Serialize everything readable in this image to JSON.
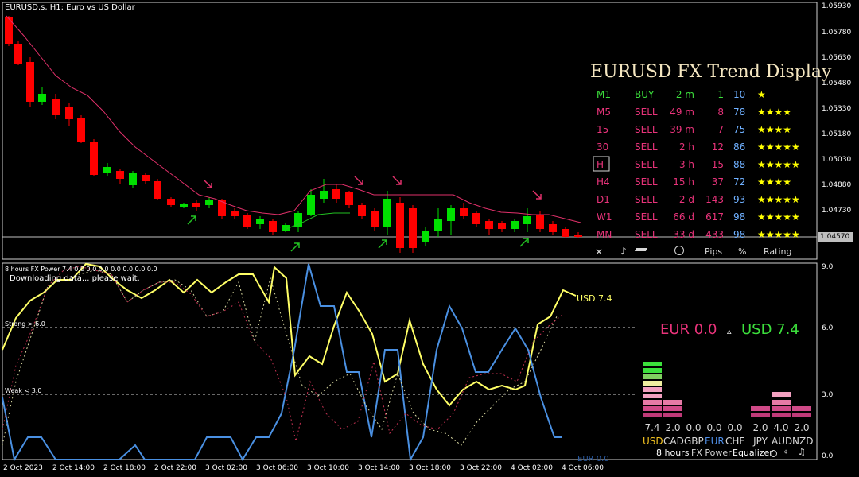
{
  "symbol_title": "EURUSD.s, H1:  Euro vs US Dollar",
  "price_axis": [
    "1.05930",
    "1.05780",
    "1.05630",
    "1.05480",
    "1.05330",
    "1.05180",
    "1.05030",
    "1.04880",
    "1.04730",
    "1.04570"
  ],
  "current_price": "1.04570",
  "trend_panel": {
    "title": "EURUSD FX Trend Display",
    "rows": [
      {
        "tf": "M1",
        "signal": "BUY",
        "time": "2 m",
        "pips": "1",
        "pct": "10",
        "stars": "★",
        "color": "#3ce03c"
      },
      {
        "tf": "M5",
        "signal": "SELL",
        "time": "49 m",
        "pips": "8",
        "pct": "78",
        "stars": "★★★★",
        "color": "#e8337a"
      },
      {
        "tf": "15",
        "signal": "SELL",
        "time": "39 m",
        "pips": "7",
        "pct": "75",
        "stars": "★★★★",
        "color": "#e8337a"
      },
      {
        "tf": "30",
        "signal": "SELL",
        "time": "2 h",
        "pips": "12",
        "pct": "86",
        "stars": "★★★★★",
        "color": "#e8337a"
      },
      {
        "tf": "H",
        "signal": "SELL",
        "time": "3 h",
        "pips": "15",
        "pct": "88",
        "stars": "★★★★★",
        "color": "#e8337a"
      },
      {
        "tf": "H4",
        "signal": "SELL",
        "time": "15 h",
        "pips": "37",
        "pct": "72",
        "stars": "★★★★",
        "color": "#e8337a"
      },
      {
        "tf": "D1",
        "signal": "SELL",
        "time": "2 d",
        "pips": "143",
        "pct": "93",
        "stars": "★★★★★",
        "color": "#e8337a"
      },
      {
        "tf": "W1",
        "signal": "SELL",
        "time": "66 d",
        "pips": "617",
        "pct": "98",
        "stars": "★★★★★",
        "color": "#e8337a"
      },
      {
        "tf": "MN",
        "signal": "SELL",
        "time": "33 d",
        "pips": "433",
        "pct": "98",
        "stars": "★★★★★",
        "color": "#e8337a"
      }
    ],
    "footer": {
      "close": "✕",
      "sound": "♪",
      "pips": "Pips",
      "pct": "%",
      "rating": "Rating"
    }
  },
  "indicator": {
    "title": "8 hours FX Power 7.4 0.0 0.0 0.0 0.0 0.0 0.0 0.0",
    "status": "Downloading data... please wait.",
    "strong_label": "Strong > 6.0",
    "weak_label": "Weak < 3.0",
    "usd_tag": "USD 7.4",
    "eur_strength": "EUR 0.0",
    "usd_strength": "USD 7.4",
    "delta_symbol": "▵",
    "axis": [
      "9.0",
      "6.0",
      "3.0",
      "0.0"
    ],
    "eur_bottom_label": "EUR 0.0"
  },
  "equalizer": {
    "currencies": [
      {
        "code": "USD",
        "value": "7.4",
        "color": "#f0c020"
      },
      {
        "code": "CAD",
        "value": "2.0",
        "color": "#d8d8d8"
      },
      {
        "code": "GBP",
        "value": "0.0",
        "color": "#d8d8d8"
      },
      {
        "code": "EUR",
        "value": "0.0",
        "color": "#4f8fe8"
      },
      {
        "code": "CHF",
        "value": "0.0",
        "color": "#d8d8d8"
      },
      {
        "code": "JPY",
        "value": "2.0",
        "color": "#d8d8d8"
      },
      {
        "code": "AUD",
        "value": "4.0",
        "color": "#d8d8d8"
      },
      {
        "code": "NZD",
        "value": "2.0",
        "color": "#d8d8d8"
      }
    ],
    "footer": {
      "period": "8 hours",
      "name": "FX Power",
      "mode": "Equalizer"
    }
  },
  "time_axis": [
    "2 Oct 2023",
    "2 Oct 14:00",
    "2 Oct 18:00",
    "2 Oct 22:00",
    "3 Oct 02:00",
    "3 Oct 06:00",
    "3 Oct 10:00",
    "3 Oct 14:00",
    "3 Oct 18:00",
    "3 Oct 22:00",
    "4 Oct 02:00",
    "4 Oct 06:00"
  ],
  "colors": {
    "bull": "#00e000",
    "bear": "#ff0000",
    "ma": "#e0306a",
    "usd_line": "#ffff66",
    "eur_line": "#4a90e2"
  }
}
